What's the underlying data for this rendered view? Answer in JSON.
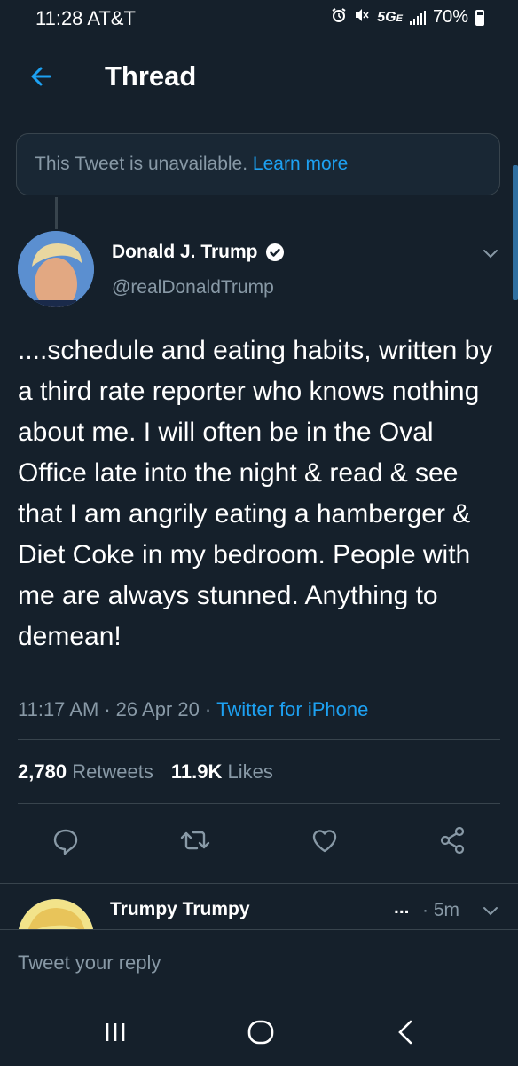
{
  "status_bar": {
    "time": "11:28 AT&T",
    "network": "5G",
    "network_sub": "E",
    "battery": "70%"
  },
  "header": {
    "title": "Thread"
  },
  "unavailable": {
    "text": "This Tweet is unavailable.",
    "link": "Learn more"
  },
  "tweet": {
    "author_name": "Donald J. Trump",
    "handle": "@realDonaldTrump",
    "text": "....schedule and eating habits, written by a third rate reporter who knows nothing about me. I will often be in the Oval Office late into the night & read & see that I am angrily eating a hamberger & Diet Coke in my bedroom. People with me are always stunned. Anything to demean!",
    "time": "11:17 AM",
    "date": "26 Apr 20",
    "source": "Twitter for iPhone",
    "retweets_count": "2,780",
    "retweets_label": "Retweets",
    "likes_count": "11.9K",
    "likes_label": "Likes"
  },
  "reply_preview": {
    "name": "Trumpy Trumpy",
    "dots": "...",
    "time": "· 5m"
  },
  "reply_box": {
    "placeholder": "Tweet your reply"
  },
  "colors": {
    "background": "#15202b",
    "accent": "#1da1f2",
    "secondary_text": "#8899a6"
  },
  "icons": {
    "back": "arrow-left-icon",
    "verified": "verified-badge-icon",
    "reply": "reply-icon",
    "retweet": "retweet-icon",
    "like": "heart-icon",
    "share": "share-icon"
  }
}
